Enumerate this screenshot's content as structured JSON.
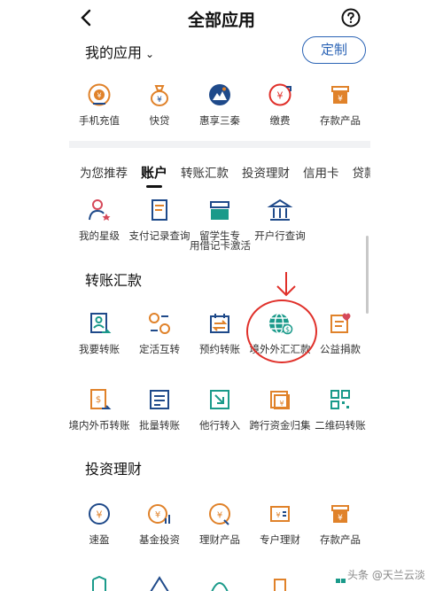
{
  "header": {
    "title": "全部应用"
  },
  "my_apps": {
    "label": "我的应用",
    "chevron": "⌄",
    "custom_label": "定制",
    "items": [
      {
        "label": "手机充值",
        "icon": "phone-topup-icon"
      },
      {
        "label": "快贷",
        "icon": "money-bag-icon"
      },
      {
        "label": "惠享三秦",
        "icon": "mountain-badge-icon"
      },
      {
        "label": "缴费",
        "icon": "payment-icon"
      },
      {
        "label": "存款产品",
        "icon": "deposit-jar-icon"
      }
    ]
  },
  "tabs": [
    "为您推荐",
    "账户",
    "转账汇款",
    "投资理财",
    "信用卡",
    "贷款"
  ],
  "active_tab": "账户",
  "account_row": [
    {
      "label": "我的星级",
      "icon": "person-star-icon"
    },
    {
      "label": "支付记录查询",
      "icon": "receipt-icon"
    },
    {
      "label": "留学生专",
      "icon": "card-icon"
    },
    {
      "label": "开户行查询",
      "icon": "bank-icon"
    }
  ],
  "account_row_second_line": "用借记卡激活",
  "transfer": {
    "title": "转账汇款",
    "row1": [
      {
        "label": "我要转账",
        "icon": "transfer-person-icon"
      },
      {
        "label": "定活互转",
        "icon": "exchange-coins-icon"
      },
      {
        "label": "预约转账",
        "icon": "calendar-transfer-icon"
      },
      {
        "label": "境外外汇汇款",
        "icon": "globe-dollar-icon"
      },
      {
        "label": "公益捐款",
        "icon": "charity-heart-icon"
      }
    ],
    "row2": [
      {
        "label": "境内外币转账",
        "icon": "foreign-currency-icon"
      },
      {
        "label": "批量转账",
        "icon": "batch-list-icon"
      },
      {
        "label": "他行转入",
        "icon": "inbound-transfer-icon"
      },
      {
        "label": "跨行资金归集",
        "icon": "collect-funds-icon"
      },
      {
        "label": "二维码转账",
        "icon": "qr-code-icon"
      }
    ]
  },
  "invest": {
    "title": "投资理财",
    "row1": [
      {
        "label": "速盈",
        "icon": "quick-yield-icon"
      },
      {
        "label": "基金投资",
        "icon": "fund-icon"
      },
      {
        "label": "理财产品",
        "icon": "wealth-icon"
      },
      {
        "label": "专户理财",
        "icon": "special-account-icon"
      },
      {
        "label": "存款产品",
        "icon": "deposit-jar-icon"
      }
    ]
  },
  "watermark": "头条 @天兰云淡",
  "colors": {
    "orange": "#e0822a",
    "teal": "#1a9a8a",
    "navy": "#1f4a8a",
    "red": "#e0302a",
    "pink": "#d6495a"
  }
}
